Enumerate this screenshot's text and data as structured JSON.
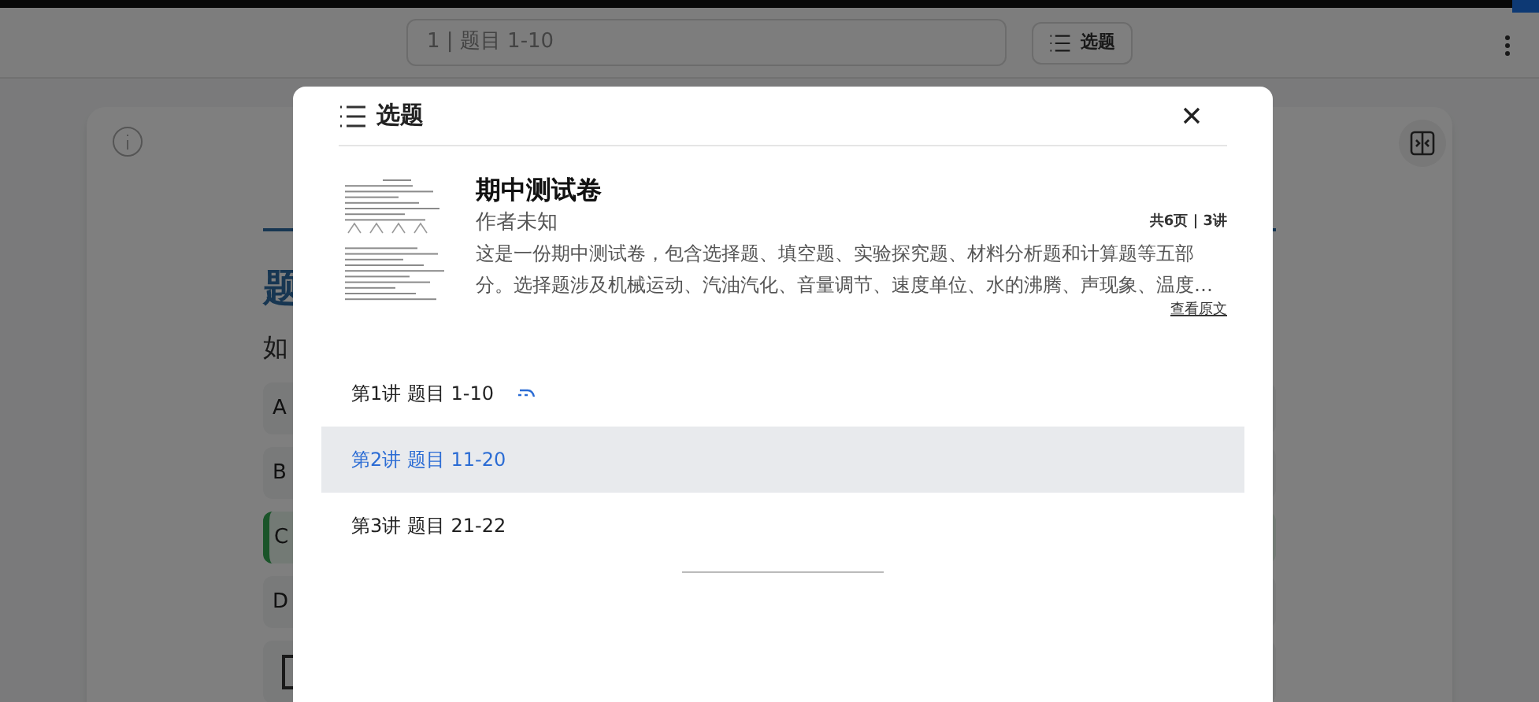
{
  "top_bar": {
    "lecture_field": {
      "value": "1 | 题目 1-10"
    },
    "select_button": "选题"
  },
  "question_card": {
    "heading": "题",
    "question": "如",
    "options": [
      {
        "label": "A",
        "selected": false
      },
      {
        "label": "B",
        "selected": false
      },
      {
        "label": "C",
        "selected": true
      },
      {
        "label": "D",
        "selected": false
      }
    ]
  },
  "dialog": {
    "title": "选题",
    "document": {
      "title": "期中测试卷",
      "author": "作者未知",
      "stats": "共6页 | 3讲",
      "description": "这是一份期中测试卷，包含选择题、填空题、实验探究题、材料分析题和计算题等五部分。选择题涉及机械运动、汽油汽化、音量调节、速度单位、水的沸腾、声现象、温度…",
      "link": "查看原文"
    },
    "lectures": [
      {
        "label": "第1讲 题目 1-10",
        "selected": false,
        "playing": true
      },
      {
        "label": "第2讲 题目 11-20",
        "selected": true,
        "playing": false
      },
      {
        "label": "第3讲 题目 21-22",
        "selected": false,
        "playing": false
      }
    ]
  }
}
